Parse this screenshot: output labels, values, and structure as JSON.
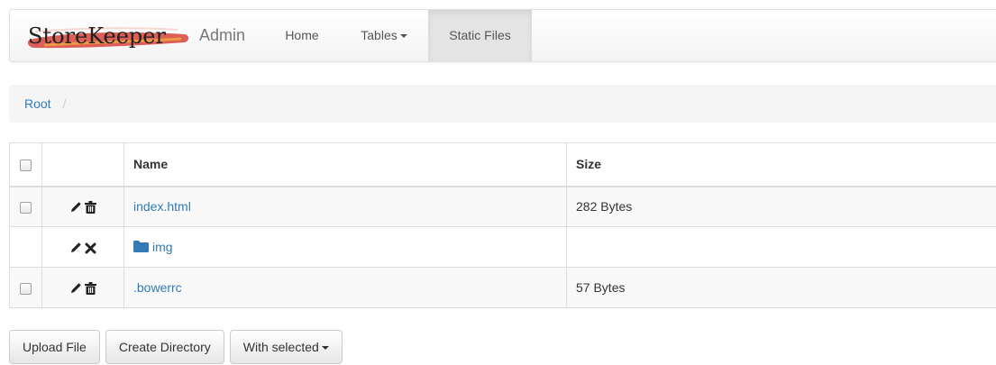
{
  "navbar": {
    "brand": "StoreKeeper",
    "section": "Admin",
    "items": [
      {
        "label": "Home",
        "active": false
      },
      {
        "label": "Tables",
        "active": false,
        "dropdown": true
      },
      {
        "label": "Static Files",
        "active": true
      }
    ]
  },
  "breadcrumb": {
    "items": [
      "Root"
    ],
    "separator": "/"
  },
  "table": {
    "columns": [
      "",
      "",
      "Name",
      "Size"
    ],
    "rows": [
      {
        "name": "index.html",
        "size": "282 Bytes",
        "type": "file",
        "selectable": true,
        "icons": [
          "pencil-icon",
          "trash-icon"
        ]
      },
      {
        "name": "img",
        "size": "",
        "type": "directory",
        "selectable": false,
        "icons": [
          "pencil-icon",
          "remove-icon",
          "folder-icon"
        ]
      },
      {
        "name": ".bowerrc",
        "size": "57 Bytes",
        "type": "file",
        "selectable": true,
        "icons": [
          "pencil-icon",
          "trash-icon"
        ]
      }
    ]
  },
  "buttons": {
    "upload": "Upload File",
    "create_dir": "Create Directory",
    "with_selected": "With selected"
  },
  "colors": {
    "link": "#337ab7",
    "active_nav_bg": "#e4e4e4",
    "breadcrumb_bg": "#f5f5f5",
    "brand_swash": "#d8433a"
  }
}
